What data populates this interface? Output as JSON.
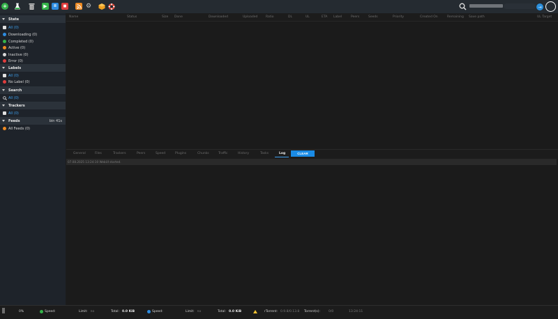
{
  "toolbar": {
    "icons": [
      {
        "name": "add-torrent-icon",
        "color": "#35b34a",
        "glyph": "+"
      },
      {
        "name": "create-torrent-icon",
        "color": "#e3e3e3",
        "glyph": "⚗"
      },
      {
        "name": "delete-icon",
        "color": "#c7c7c7",
        "glyph": ""
      },
      {
        "name": "start-icon",
        "color": "#35b34a",
        "glyph": "▶"
      },
      {
        "name": "pause-icon",
        "color": "#2e8ce0",
        "glyph": "II"
      },
      {
        "name": "stop-icon",
        "color": "#df3d3d",
        "glyph": "■"
      },
      {
        "name": "rss-icon",
        "color": "#ee8a22",
        "glyph": ""
      },
      {
        "name": "settings-icon",
        "color": "#c7c7c7",
        "glyph": "⚙"
      },
      {
        "name": "plugins-icon",
        "color": "#f0a020",
        "glyph": "◆"
      },
      {
        "name": "help-icon",
        "color": "#e24a3b",
        "glyph": "✚"
      }
    ]
  },
  "sidebar": {
    "state": {
      "title": "State",
      "items": [
        {
          "label": "All (0)",
          "color": "#e0e0e0",
          "selected": true
        },
        {
          "label": "Downloading (0)",
          "color": "#2e8ce0"
        },
        {
          "label": "Completed (0)",
          "color": "#35b34a"
        },
        {
          "label": "Active (0)",
          "color": "#ee8a22"
        },
        {
          "label": "Inactive (0)",
          "color": "#d8d8d8"
        },
        {
          "label": "Error (0)",
          "color": "#df3d3d"
        }
      ]
    },
    "labels": {
      "title": "Labels",
      "items": [
        {
          "label": "All (0)",
          "color": "#e0e0e0",
          "selected": true
        },
        {
          "label": "No Label (0)",
          "color": "#df3d3d"
        }
      ]
    },
    "search": {
      "title": "Search",
      "items": [
        {
          "label": "All (0)",
          "selected": true
        }
      ]
    },
    "trackers": {
      "title": "Trackers",
      "items": [
        {
          "label": "All (0)",
          "color": "#e0e0e0",
          "selected": true
        }
      ]
    },
    "feeds": {
      "title": "Feeds",
      "extra": "bin 41s",
      "items": [
        {
          "label": "All Feeds (0)",
          "color": "#ee8a22"
        }
      ]
    }
  },
  "table": {
    "columns": [
      "Name",
      "Status",
      "Size",
      "Done",
      "Downloaded",
      "Uploaded",
      "Ratio",
      "DL",
      "UL",
      "ETA",
      "Label",
      "Peers",
      "Seeds",
      "Priority",
      "Created On",
      "Remaining",
      "Save path",
      "UL Target"
    ]
  },
  "bottom": {
    "tabs": [
      "General",
      "Files",
      "Trackers",
      "Peers",
      "Speed",
      "Plugins",
      "Chunks",
      "Traffic",
      "History",
      "Tasks",
      "Log"
    ],
    "active_tab": "Log",
    "clear_label": "CLEAR",
    "log_line": "07.08.2025 13:24:10 WebUI started."
  },
  "statusbar": {
    "progress": "0%",
    "dl_label": "Speed:",
    "dl_limit_label": "Limit:",
    "dl_limit_value": "no",
    "dl_total_label": "Total:",
    "dl_total_value": "0.0 KiB",
    "ul_label": "Speed:",
    "ul_limit_label": "Limit:",
    "ul_limit_value": "no",
    "ul_total_label": "Total:",
    "ul_total_value": "0.0 KiB",
    "rtorrent_label": "rTorrent:",
    "rtorrent_value": "0.9.8/0.13.8",
    "torrents_label": "Torrent(s):",
    "torrents_value": "0/0",
    "time": "13:24:11"
  }
}
